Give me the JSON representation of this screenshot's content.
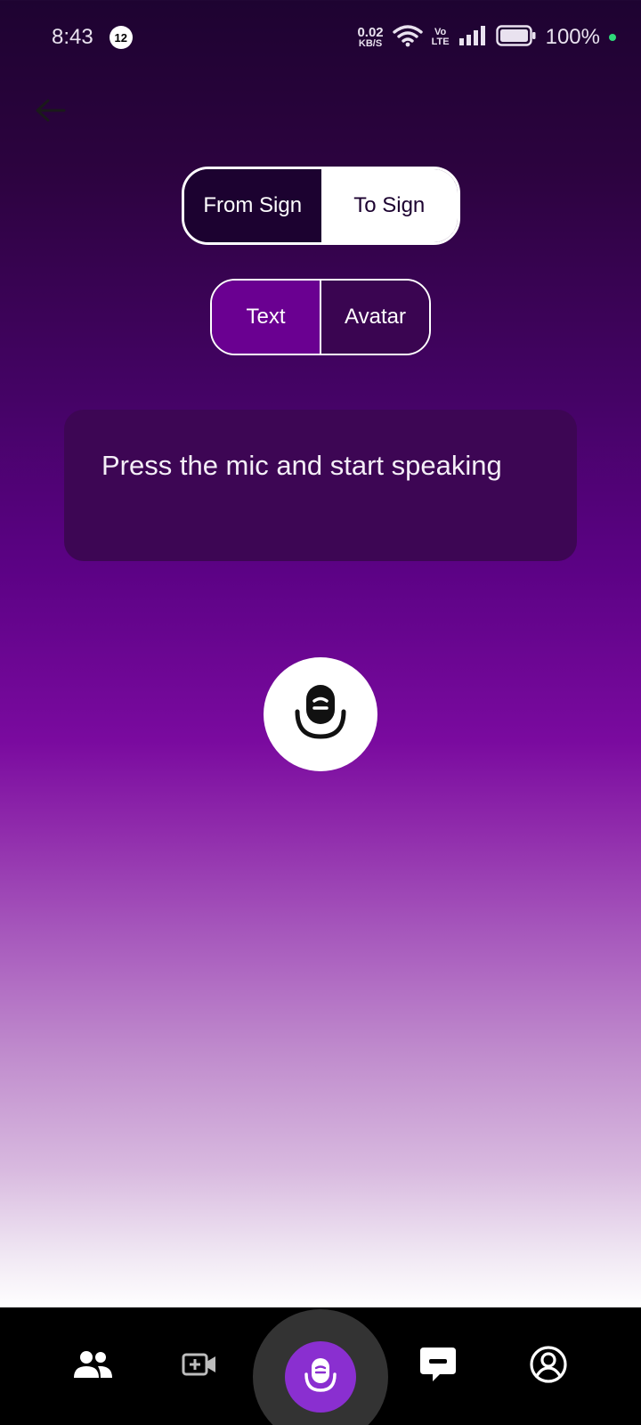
{
  "status_bar": {
    "time": "8:43",
    "notification_count": "12",
    "net_speed_value": "0.02",
    "net_speed_unit": "KB/S",
    "volte_top": "Vo",
    "volte_bottom": "LTE",
    "battery": "100%"
  },
  "mode_toggle": {
    "from_label": "From Sign",
    "to_label": "To Sign",
    "selected": "From Sign"
  },
  "output_toggle": {
    "text_label": "Text",
    "avatar_label": "Avatar",
    "selected": "Text"
  },
  "prompt": {
    "text": "Press the mic and start speaking"
  },
  "icons": {
    "back": "arrow-left-icon",
    "mic": "microphone-icon",
    "nav": [
      "people-icon",
      "video-add-icon",
      "microphone-icon",
      "chat-icon",
      "profile-icon"
    ]
  },
  "colors": {
    "accent": "#8a2fd0",
    "card": "#3d0654",
    "active_segment": "#6a0091"
  }
}
